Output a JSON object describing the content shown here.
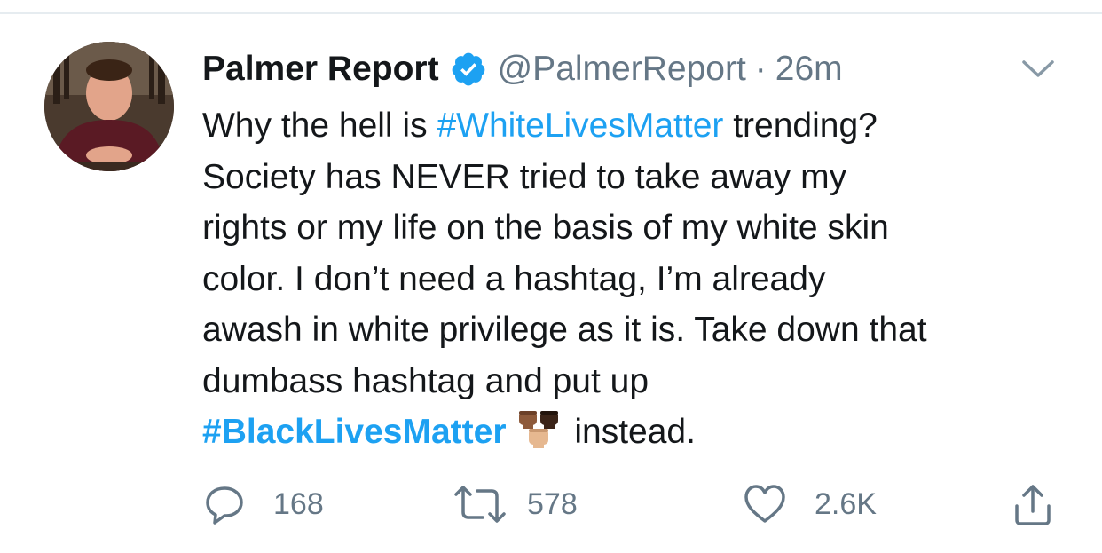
{
  "tweet": {
    "author_name": "Palmer Report",
    "handle": "@PalmerReport",
    "separator": "·",
    "time": "26m",
    "text": {
      "l1_a": "Why the hell is ",
      "l1_tag": "#WhiteLivesMatter",
      "l1_b": " trending?",
      "l2": "Society has NEVER tried to take away my",
      "l3": "rights or my life on the basis of my white skin",
      "l4": "color. I don’t need a hashtag, I’m already",
      "l5": "awash in white privilege as it is. Take down that",
      "l6": "dumbass hashtag and put up",
      "l7_tag": "#BlackLivesMatter",
      "l7_b": " instead."
    },
    "emoji": "raised-fist-emoji-cluster"
  },
  "actions": {
    "replies": "168",
    "retweets": "578",
    "likes": "2.6K"
  },
  "colors": {
    "hashtag": "#1da1f2",
    "verified": "#1da1f2",
    "secondary": "#657786",
    "divider": "#e6ecf0"
  },
  "icons": [
    "verified-badge-icon",
    "chevron-down-icon",
    "reply-icon",
    "retweet-icon",
    "like-icon",
    "share-icon"
  ]
}
